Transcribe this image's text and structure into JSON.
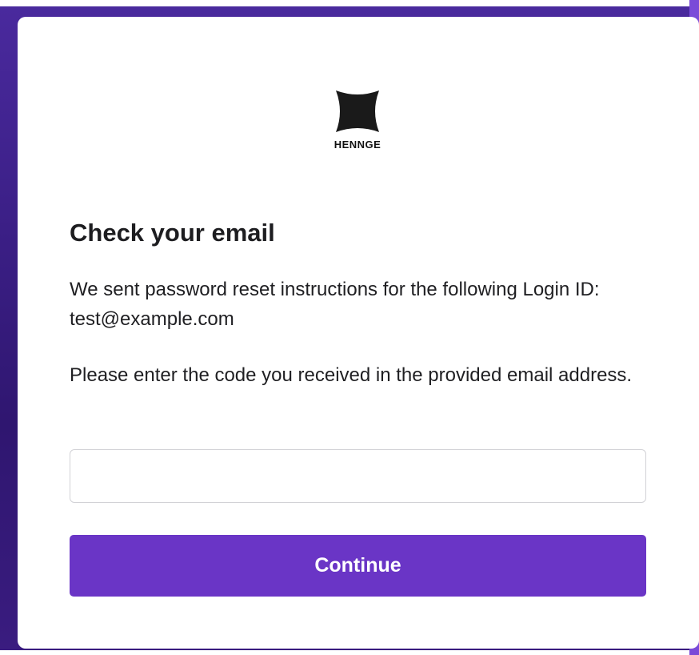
{
  "brand": {
    "logo_icon": "henne-star-icon",
    "name": "HENNGE"
  },
  "heading": "Check your email",
  "message": {
    "sent_line": "We sent password reset instructions for the following Login ID: test@example.com",
    "instruction": "Please enter the code you received in the provided email address."
  },
  "code_field": {
    "value": "",
    "placeholder": ""
  },
  "continue_label": "Continue",
  "colors": {
    "accent": "#6a35c6",
    "background": "#3b1f86"
  }
}
